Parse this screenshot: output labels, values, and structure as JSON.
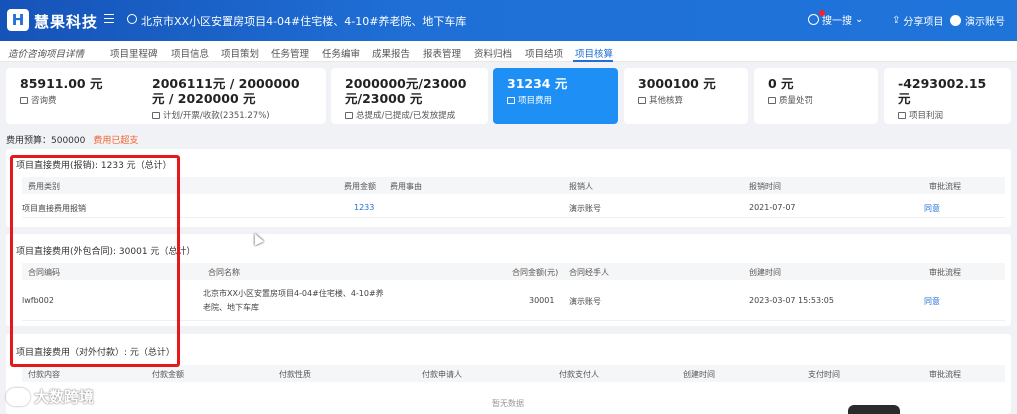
{
  "header": {
    "logo_mark": "H",
    "logo_text": "慧果科技",
    "project_title": "北京市XX小区安置房项目4-04#住宅楼、4-10#养老院、地下车库",
    "search_label": "搜一搜",
    "share_label": "分享项目",
    "user_label": "演示账号"
  },
  "tabs": {
    "page_label": "造价咨询项目详情",
    "items": [
      "项目里程碑",
      "项目信息",
      "项目策划",
      "任务管理",
      "任务编审",
      "成果报告",
      "报表管理",
      "资料归档",
      "项目结项",
      "项目核算"
    ],
    "active": "项目核算"
  },
  "cards": [
    {
      "value": "85911.00 元",
      "label": "咨询费"
    },
    {
      "value": "2006111元 / 2000000元 / 2020000 元",
      "label": "计划/开票/收款(2351.27%)"
    },
    {
      "value": "2000000元/23000元/23000 元",
      "label": "总提成/已提成/已发放提成"
    },
    {
      "value": "31234 元",
      "label": "项目费用"
    },
    {
      "value": "3000100 元",
      "label": "其他核算"
    },
    {
      "value": "0 元",
      "label": "质量处罚"
    },
    {
      "value": "-4293002.15 元",
      "label": "项目利润"
    }
  ],
  "budget": {
    "label": "费用预算：500000",
    "warning": "费用已超支"
  },
  "section1": {
    "title": "项目直接费用(报销): 1233 元（总计）",
    "columns": [
      "费用类别",
      "费用金额",
      "费用事由",
      "报销人",
      "报销时间",
      "审批流程"
    ],
    "rows": [
      {
        "category": "项目直接费用报销",
        "amount": "1233",
        "reason": "",
        "person": "演示账号",
        "time": "2021-07-07",
        "flow": "同意"
      }
    ]
  },
  "section2": {
    "title": "项目直接费用(外包合同): 30001 元（总计）",
    "columns": [
      "合同编码",
      "合同名称",
      "合同金额(元)",
      "合同经手人",
      "创建时间",
      "审批流程"
    ],
    "rows": [
      {
        "code": "lwfb002",
        "name_line1": "北京市XX小区安置房项目4-04#住宅楼、4-10#养",
        "name_line2": "老院、地下车库",
        "amount": "30001",
        "handler": "演示账号",
        "time": "2023-03-07 15:53:05",
        "flow": "同意"
      }
    ]
  },
  "section3": {
    "title": "项目直接费用（对外付款）: 元（总计）",
    "columns": [
      "付款内容",
      "付款金额",
      "付款性质",
      "付款申请人",
      "付款支付人",
      "创建时间",
      "支付时间",
      "审批流程"
    ],
    "empty": "暂无数据"
  },
  "watermark": "大数跨境"
}
